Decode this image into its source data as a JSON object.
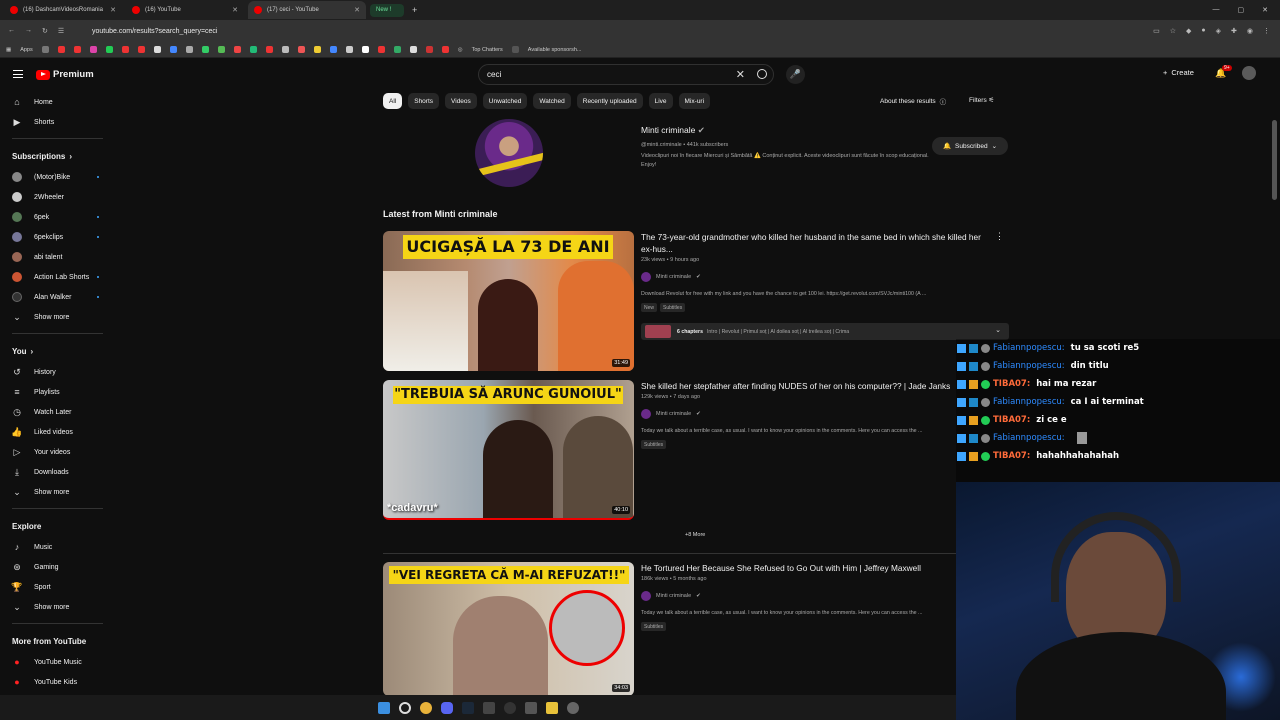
{
  "browser": {
    "tabs": [
      {
        "title": "(16) DashcamVideosRomania",
        "active": false
      },
      {
        "title": "(16) YouTube",
        "active": false
      },
      {
        "title": "(17) ceci - YouTube",
        "active": true
      }
    ],
    "new_tab_label": "New !",
    "url": "youtube.com/results?search_query=ceci",
    "bookmarks": [
      "Apps",
      "Top Chatters",
      "Available sponsorsh..."
    ]
  },
  "youtube": {
    "logo_text": "Premium",
    "search_value": "ceci",
    "create_label": "Create",
    "notif_count": "9+",
    "sidebar": {
      "top": [
        {
          "label": "Home",
          "icon": "home-icon"
        },
        {
          "label": "Shorts",
          "icon": "shorts-icon"
        }
      ],
      "subscriptions_header": "Subscriptions",
      "subscriptions": [
        {
          "label": "(Motor)Bike",
          "color": "#888888",
          "dot": true
        },
        {
          "label": "2Wheeler",
          "color": "#cccccc",
          "dot": false
        },
        {
          "label": "6pek",
          "color": "#557755",
          "dot": true
        },
        {
          "label": "6pekclips",
          "color": "#777799",
          "dot": true
        },
        {
          "label": "abi talent",
          "color": "#996655",
          "dot": false
        },
        {
          "label": "Action Lab Shorts",
          "color": "#cc5533",
          "dot": true
        },
        {
          "label": "Alan Walker",
          "color": "#333333",
          "dot": true
        }
      ],
      "show_more": "Show more",
      "you_header": "You",
      "you_items": [
        {
          "label": "History",
          "icon": "history-icon"
        },
        {
          "label": "Playlists",
          "icon": "playlists-icon"
        },
        {
          "label": "Watch Later",
          "icon": "watch-later-icon"
        },
        {
          "label": "Liked videos",
          "icon": "liked-icon"
        },
        {
          "label": "Your videos",
          "icon": "your-videos-icon"
        },
        {
          "label": "Downloads",
          "icon": "downloads-icon"
        }
      ],
      "you_show_more": "Show more",
      "explore_header": "Explore",
      "explore_items": [
        {
          "label": "Music",
          "icon": "music-icon"
        },
        {
          "label": "Gaming",
          "icon": "gaming-icon"
        },
        {
          "label": "Sport",
          "icon": "sport-icon"
        }
      ],
      "explore_show_more": "Show more",
      "more_header": "More from YouTube",
      "more_items": [
        {
          "label": "YouTube Music"
        },
        {
          "label": "YouTube Kids"
        }
      ]
    },
    "chips": [
      "All",
      "Shorts",
      "Videos",
      "Unwatched",
      "Watched",
      "Recently uploaded",
      "Live",
      "Mix-uri"
    ],
    "about_label": "About these results",
    "filters_label": "Filters",
    "channel": {
      "name": "Minti criminale",
      "meta": "@minti.criminale • 441k subscribers",
      "description": "Videoclipuri noi în fiecare Miercuri și Sâmbătă ⚠️ Conținut explicit. Aceste videoclipuri sunt făcute în scop educațional. Enjoy!",
      "subscribe_label": "Subscribed"
    },
    "latest_heading": "Latest from Minti criminale",
    "videos": [
      {
        "thumb_text": "UCIGAȘĂ LA 73 DE ANI",
        "duration": "31:49",
        "title": "The 73-year-old grandmother who killed her husband in the same bed in which she killed her ex-hus...",
        "meta": "23k views • 9 hours ago",
        "channel": "Minti criminale",
        "desc": "Download Revolut for free with my link and you have the chance to get 100 lei. https://get.revolut.com/SVJc/minti100 (A ...",
        "tags": [
          "New",
          "Subtitles"
        ],
        "chapters_label": "6 chapters",
        "chapters_text": "Intro | Revolut | Primul soț | Al doilea soț | Al treilea soț | Crima"
      },
      {
        "thumb_text": "\"TREBUIA SĂ ARUNC GUNOIUL\"",
        "thumb_sub": "*cadavru*",
        "duration": "40:10",
        "title": "She killed her stepfather after finding NUDES of her on his computer?? | Jade Janks",
        "meta": "129k views • 7 days ago",
        "channel": "Minti criminale",
        "desc": "Today we talk about a terrible case, as usual. I want to know your opinions in the comments. Here you can access the ...",
        "tags": [
          "Subtitles"
        ]
      },
      {
        "thumb_text": "\"VEI REGRETA CĂ M-AI REFUZAT!!\"",
        "duration": "34:03",
        "title": "He Tortured Her Because She Refused to Go Out with Him | Jeffrey Maxwell",
        "meta": "186k views • 5 months ago",
        "channel": "Minti criminale",
        "desc": "Today we talk about a terrible case, as usual. I want to know your opinions in the comments. Here you can access the ...",
        "tags": [
          "Subtitles"
        ]
      }
    ],
    "more_label": "+8 More"
  },
  "chat": [
    {
      "user": "Fabiannpopescu:",
      "text": "tu sa scoti re5",
      "red": false
    },
    {
      "user": "Fabiannpopescu:",
      "text": "din titlu",
      "red": false
    },
    {
      "user": "TIBA07:",
      "text": "hai ma rezar",
      "red": true
    },
    {
      "user": "Fabiannpopescu:",
      "text": "ca I ai terminat",
      "red": false
    },
    {
      "user": "TIBA07:",
      "text": "zi ce e",
      "red": true
    },
    {
      "user": "Fabiannpopescu:",
      "text": "",
      "red": false
    },
    {
      "user": "TIBA07:",
      "text": "hahahhahahahah",
      "red": true
    }
  ]
}
